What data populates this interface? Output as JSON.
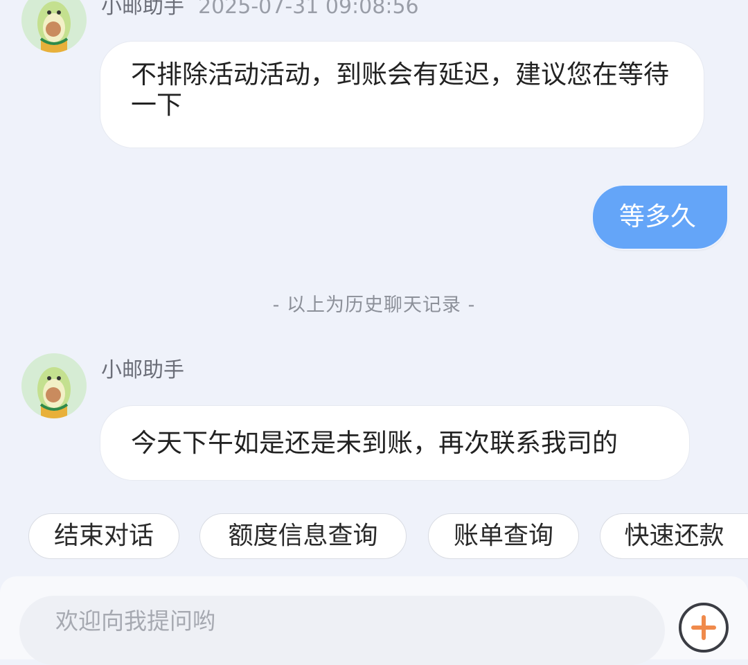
{
  "messages": [
    {
      "sender": "小邮助手",
      "timestamp": "2025-07-31 09:08:56",
      "text": "不排除活动活动，到账会有延迟，建议您在等待一下"
    },
    {
      "text": "等多久"
    },
    {
      "sender": "小邮助手",
      "text": "今天下午如是还是未到账，再次联系我司的"
    }
  ],
  "history_divider": "- 以上为历史聊天记录 -",
  "quick_actions": [
    "结束对话",
    "额度信息查询",
    "账单查询",
    "快速还款"
  ],
  "input": {
    "placeholder": "欢迎向我提问哟"
  },
  "colors": {
    "page_background": "#eff2fa",
    "user_bubble": "#64a5f8",
    "bot_bubble": "#ffffff",
    "plus_icon_accent": "#f08a4b"
  },
  "icons": {
    "avatar": "avocado-mascot-icon",
    "attach": "plus-circle-icon"
  }
}
